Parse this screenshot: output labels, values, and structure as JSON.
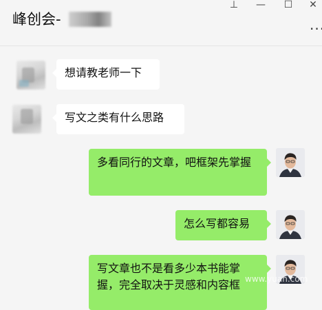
{
  "window": {
    "title_prefix": "峰创会-",
    "controls": {
      "pin": "⊥",
      "minimize": "—",
      "maximize": "☐",
      "close": "✕"
    },
    "more": "···"
  },
  "messages": [
    {
      "side": "left",
      "text": "想请教老师一下"
    },
    {
      "side": "left",
      "text": "写文之类有什么思路"
    },
    {
      "side": "right",
      "text": "多看同行的文章，吧框架先掌握"
    },
    {
      "side": "right",
      "text": "怎么写都容易"
    },
    {
      "side": "right",
      "text": "写文章也不是看多少本书能掌握，完全取决于灵感和内容框"
    }
  ],
  "watermark": "www.yuan.com",
  "colors": {
    "sent_bubble": "#95ec69",
    "received_bubble": "#ffffff",
    "background": "#f5f5f5"
  },
  "icons": [
    "pin-icon",
    "minimize-icon",
    "maximize-icon",
    "close-icon",
    "more-icon"
  ]
}
